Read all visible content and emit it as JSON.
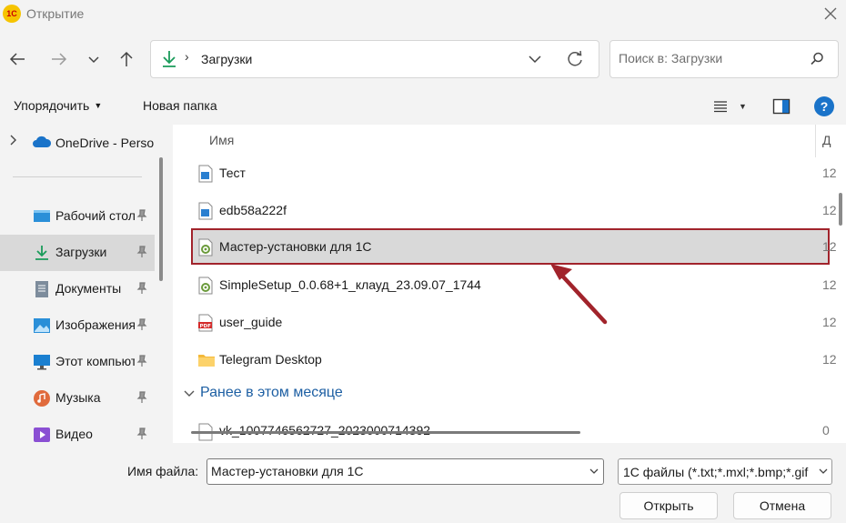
{
  "window": {
    "logo_text": "1C",
    "title": "Открытие"
  },
  "nav": {
    "breadcrumb_separator": "›",
    "current_folder": "Загрузки",
    "search_placeholder": "Поиск в: Загрузки"
  },
  "toolbar": {
    "organize_label": "Упорядочить",
    "new_folder_label": "Новая папка",
    "help_label": "?"
  },
  "sidebar": {
    "onedrive_label": "OneDrive - Personal",
    "items": [
      {
        "label": "Рабочий стол",
        "icon": "desktop-icon",
        "selected": false
      },
      {
        "label": "Загрузки",
        "icon": "downloads-icon",
        "selected": true
      },
      {
        "label": "Документы",
        "icon": "documents-icon",
        "selected": false
      },
      {
        "label": "Изображения",
        "icon": "pictures-icon",
        "selected": false
      },
      {
        "label": "Этот компьютер",
        "icon": "this-pc-icon",
        "selected": false
      },
      {
        "label": "Музыка",
        "icon": "music-icon",
        "selected": false
      },
      {
        "label": "Видео",
        "icon": "video-icon",
        "selected": false
      }
    ]
  },
  "file_list": {
    "column_name": "Имя",
    "column_date": "Д",
    "files": [
      {
        "name": "Тест",
        "icon": "text-file-icon",
        "date": "12"
      },
      {
        "name": "edb58a222f",
        "icon": "text-file-icon",
        "date": "12"
      },
      {
        "name": "Мастер-установки для 1С",
        "icon": "setup-icon",
        "date": "12",
        "selected": true
      },
      {
        "name": "SimpleSetup_0.0.68+1_клауд_23.09.07_1744",
        "icon": "setup-icon",
        "date": "12"
      },
      {
        "name": "user_guide",
        "icon": "pdf-icon",
        "date": "12"
      },
      {
        "name": "Telegram Desktop",
        "icon": "folder-icon",
        "date": "12"
      }
    ],
    "group_label": "Ранее в этом месяце",
    "partial_row_name": "vk_1007746562727_2023000714392",
    "partial_row_date": "0"
  },
  "footer": {
    "filename_label": "Имя файла:",
    "filename_value": "Мастер-установки для 1С",
    "filetype_value": "1С файлы (*.txt;*.mxl;*.bmp;*.gif",
    "open_label": "Открыть",
    "cancel_label": "Отмена"
  },
  "colors": {
    "accent_blue": "#1a73c9",
    "highlight_border": "#a1232b",
    "selected_bg": "#d9d9d9",
    "group_label": "#1d5fa3"
  }
}
